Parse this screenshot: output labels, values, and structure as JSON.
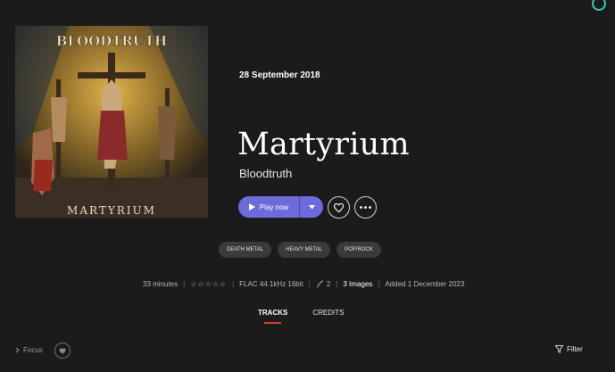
{
  "album": {
    "title": "Martyrium",
    "artist": "Bloodtruth",
    "release_date": "28 September 2018",
    "cover_text": {
      "band_logo": "BLOODTRUTH",
      "album_name": "MARTYRIUM"
    }
  },
  "actions": {
    "play_label": "Play now",
    "play_menu_icon": "caret-down-icon",
    "favorite_icon": "heart-icon",
    "more_icon": "more-dots-icon"
  },
  "tags": [
    "DEATH METAL",
    "HEAVY METAL",
    "POP/ROCK"
  ],
  "meta": {
    "duration": "33 minutes",
    "rating_stars": "☆☆☆☆☆",
    "format": "FLAC 44.1kHz 16bit",
    "discs": "2",
    "images": "3 Images",
    "added": "Added 1 December 2023"
  },
  "tabs": [
    {
      "label": "TRACKS",
      "active": true
    },
    {
      "label": "CREDITS",
      "active": false
    }
  ],
  "footer": {
    "focus_label": "Focus",
    "filter_label": "Filter"
  },
  "colors": {
    "accent": "#6d6bd9",
    "tab_underline": "#d83a3a",
    "background": "#1b1b1c"
  }
}
